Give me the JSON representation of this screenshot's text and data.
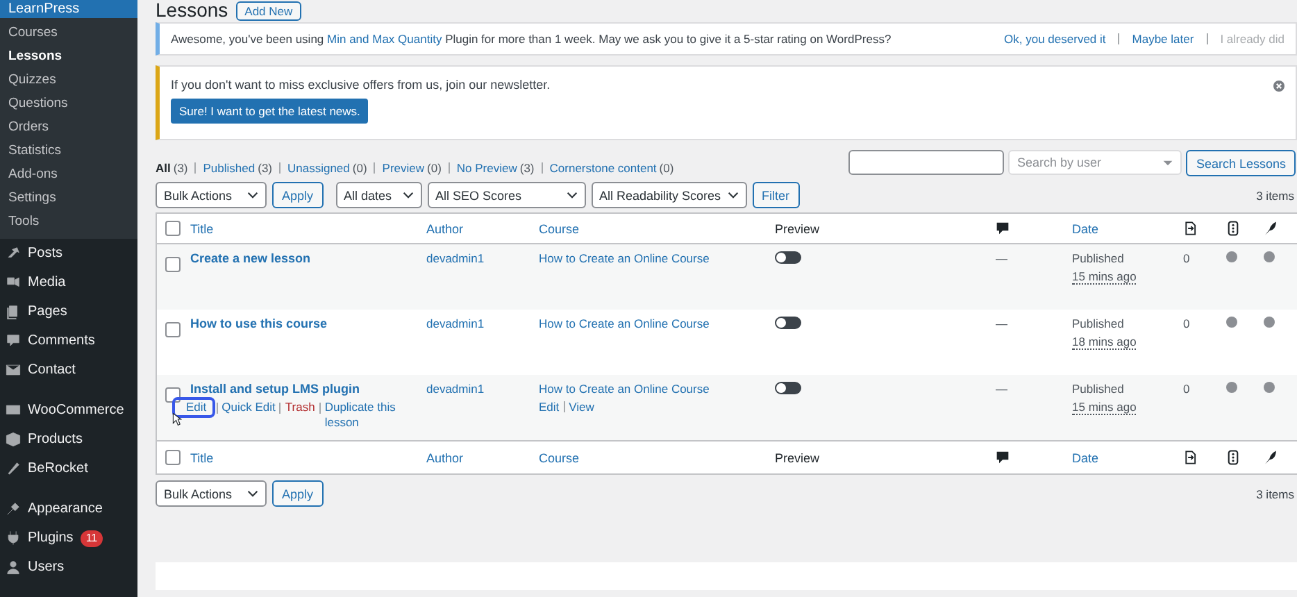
{
  "sidebar": {
    "header": {
      "label": "LearnPress",
      "selected": true
    },
    "submenu": [
      {
        "label": "Courses",
        "selected": false
      },
      {
        "label": "Lessons",
        "selected": true
      },
      {
        "label": "Quizzes",
        "selected": false
      },
      {
        "label": "Questions",
        "selected": false
      },
      {
        "label": "Orders",
        "selected": false
      },
      {
        "label": "Statistics",
        "selected": false
      },
      {
        "label": "Add-ons",
        "selected": false
      },
      {
        "label": "Settings",
        "selected": false
      },
      {
        "label": "Tools",
        "selected": false
      }
    ],
    "menu": [
      {
        "label": "Posts",
        "gap_before": false
      },
      {
        "label": "Media",
        "gap_before": false
      },
      {
        "label": "Pages",
        "gap_before": false
      },
      {
        "label": "Comments",
        "gap_before": false
      },
      {
        "label": "Contact",
        "gap_before": false
      },
      {
        "label": "WooCommerce",
        "gap_before": true
      },
      {
        "label": "Products",
        "gap_before": false
      },
      {
        "label": "BeRocket",
        "gap_before": false
      },
      {
        "label": "Appearance",
        "gap_before": true
      },
      {
        "label": "Plugins",
        "badge": "11",
        "gap_before": false
      },
      {
        "label": "Users",
        "gap_before": false
      }
    ]
  },
  "page": {
    "title": "Lessons",
    "add_new": "Add New"
  },
  "rating_notice": {
    "text_before": "Awesome, you've been using ",
    "link": "Min and Max Quantity",
    "text_after": " Plugin for more than 1 week. May we ask you to give it a 5-star rating on WordPress?",
    "actions": [
      {
        "label": "Ok, you deserved it",
        "disabled": false
      },
      {
        "label": "Maybe later",
        "disabled": false
      },
      {
        "label": "I already did",
        "disabled": true
      }
    ]
  },
  "newsletter_notice": {
    "text": "If you don't want to miss exclusive offers from us, join our newsletter.",
    "button": "Sure! I want to get the latest news."
  },
  "filters_views": [
    {
      "label": "All",
      "count": "(3)",
      "selected": true
    },
    {
      "label": "Published",
      "count": "(3)",
      "selected": false
    },
    {
      "label": "Unassigned",
      "count": "(0)",
      "selected": false
    },
    {
      "label": "Preview",
      "count": "(0)",
      "selected": false
    },
    {
      "label": "No Preview",
      "count": "(3)",
      "selected": false
    },
    {
      "label": "Cornerstone content",
      "count": "(0)",
      "selected": false
    }
  ],
  "search": {
    "user_placeholder": "Search by user",
    "button": "Search Lessons"
  },
  "toolbar": {
    "bulk_actions": "Bulk Actions",
    "apply": "Apply",
    "dates": "All dates",
    "seo": "All SEO Scores",
    "readability": "All Readability Scores",
    "filter": "Filter",
    "items": "3 items"
  },
  "table": {
    "header": {
      "checked": false,
      "columns": [
        {
          "label": "Title",
          "sortable": true
        },
        {
          "label": "Author",
          "sortable": true
        },
        {
          "label": "Course",
          "sortable": true
        },
        {
          "label": "Preview",
          "sortable": false
        },
        {
          "label": "Date",
          "sortable": true
        }
      ]
    },
    "rows": [
      {
        "checked": false,
        "title": "Create a new lesson",
        "author": "devadmin1",
        "course": "How to Create an Online Course",
        "preview_on": false,
        "comments": "—",
        "status": "Published",
        "time": "15 mins ago",
        "links": "0",
        "seo_dot": {
          "color": "#8c8f94"
        },
        "readability_dot": {
          "color": "#8c8f94"
        },
        "row_actions": [],
        "course_actions": []
      },
      {
        "checked": false,
        "title": "How to use this course",
        "author": "devadmin1",
        "course": "How to Create an Online Course",
        "preview_on": false,
        "comments": "—",
        "status": "Published",
        "time": "18 mins ago",
        "links": "0",
        "seo_dot": {
          "color": "#8c8f94"
        },
        "readability_dot": {
          "color": "#8c8f94"
        },
        "row_actions": [],
        "course_actions": []
      },
      {
        "checked": false,
        "title": "Install and setup LMS plugin",
        "author": "devadmin1",
        "course": "How to Create an Online Course",
        "preview_on": false,
        "comments": "—",
        "status": "Published",
        "time": "15 mins ago",
        "links": "0",
        "seo_dot": {
          "color": "#8c8f94"
        },
        "readability_dot": {
          "color": "#8c8f94"
        },
        "row_actions": [
          {
            "label": "Edit",
            "kind": "link",
            "focused": true
          },
          {
            "label": "Quick Edit",
            "kind": "link",
            "focused": false
          },
          {
            "label": "Trash",
            "kind": "danger",
            "focused": false
          },
          {
            "label": "Duplicate this lesson",
            "kind": "link",
            "focused": false
          }
        ],
        "course_actions": [
          "Edit",
          "View"
        ]
      }
    ],
    "footer": {
      "checked": false,
      "columns": [
        {
          "label": "Title",
          "sortable": true
        },
        {
          "label": "Author",
          "sortable": true
        },
        {
          "label": "Course",
          "sortable": true
        },
        {
          "label": "Preview",
          "sortable": false
        },
        {
          "label": "Date",
          "sortable": true
        }
      ]
    }
  },
  "bottom_toolbar": {
    "bulk_actions": "Bulk Actions",
    "apply": "Apply",
    "items": "3 items"
  }
}
